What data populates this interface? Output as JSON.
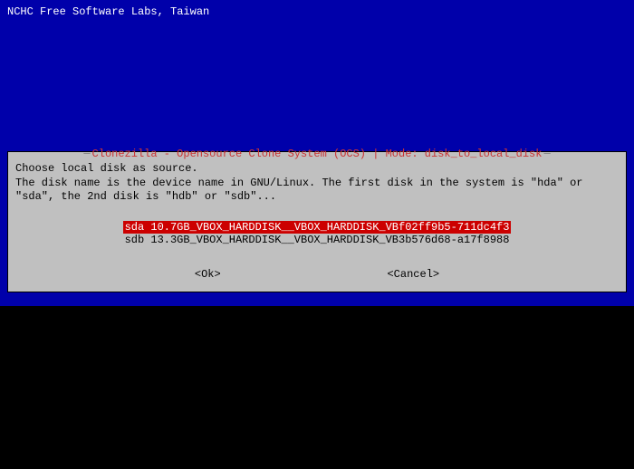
{
  "header": "NCHC Free Software Labs, Taiwan",
  "dialog": {
    "title": "Clonezilla - Opensource Clone System (OCS) | Mode: disk_to_local_disk",
    "instruction_line1": "Choose local disk as source.",
    "instruction_line2": "The disk name is the device name in GNU/Linux. The first disk in the system is \"hda\" or \"sda\", the 2nd disk is \"hdb\" or \"sdb\"..."
  },
  "disks": {
    "item0": "sda 10.7GB_VBOX_HARDDISK__VBOX_HARDDISK_VBf02ff9b5-711dc4f3",
    "item1": "sdb 13.3GB_VBOX_HARDDISK__VBOX_HARDDISK_VB3b576d68-a17f8988"
  },
  "buttons": {
    "ok": "<Ok>",
    "cancel": "<Cancel>"
  }
}
